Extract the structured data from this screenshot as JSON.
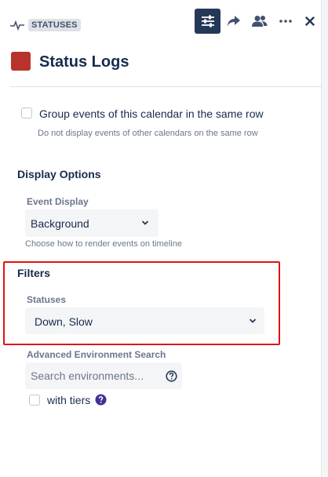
{
  "header": {
    "tag": "STATUSES",
    "title": "Status Logs",
    "swatch_color": "#b8332b",
    "actions": [
      {
        "icon": "sliders-icon",
        "active": true
      },
      {
        "icon": "share-icon",
        "active": false
      },
      {
        "icon": "people-icon",
        "active": false
      },
      {
        "icon": "more-icon",
        "active": false
      },
      {
        "icon": "close-icon",
        "active": false
      }
    ]
  },
  "group_events": {
    "label": "Group events of this calendar in the same row",
    "help": "Do not display events of other calendars on the same row",
    "checked": false
  },
  "display_options": {
    "title": "Display Options",
    "event_display_label": "Event Display",
    "event_display_value": "Background",
    "event_display_help": "Choose how to render events on timeline"
  },
  "filters": {
    "title": "Filters",
    "statuses_label": "Statuses",
    "statuses_value": "Down, Slow",
    "highlight_color": "#e01212"
  },
  "advanced_search": {
    "label": "Advanced Environment Search",
    "placeholder": "Search environments...",
    "with_tiers_label": "with tiers",
    "with_tiers_checked": false
  }
}
